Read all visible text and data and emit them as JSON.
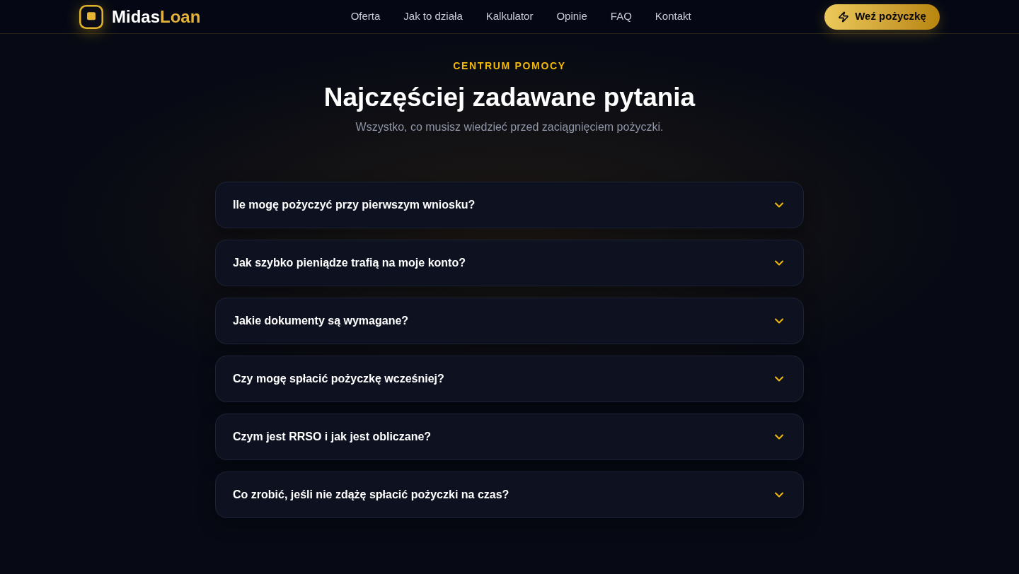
{
  "header": {
    "logo": {
      "text_first": "Midas",
      "text_second": "Loan"
    },
    "nav": [
      "Oferta",
      "Jak to działa",
      "Kalkulator",
      "Opinie",
      "FAQ",
      "Kontakt"
    ],
    "cta": "Weź pożyczkę"
  },
  "faq": {
    "eyebrow": "CENTRUM POMOCY",
    "title": "Najczęściej zadawane pytania",
    "subtitle": "Wszystko, co musisz wiedzieć przed zaciągnięciem pożyczki.",
    "items": [
      {
        "question": "Ile mogę pożyczyć przy pierwszym wniosku?",
        "expanded": false
      },
      {
        "question": "Jak szybko pieniądze trafią na moje konto?",
        "expanded": false
      },
      {
        "question": "Jakie dokumenty są wymagane?",
        "expanded": false
      },
      {
        "question": "Czy mogę spłacić pożyczkę wcześniej?",
        "expanded": false
      },
      {
        "question": "Czym jest RRSO i jak jest obliczane?",
        "expanded": false
      },
      {
        "question": "Co zrobić, jeśli nie zdążę spłacić pożyczki na czas?",
        "expanded": false
      }
    ]
  }
}
